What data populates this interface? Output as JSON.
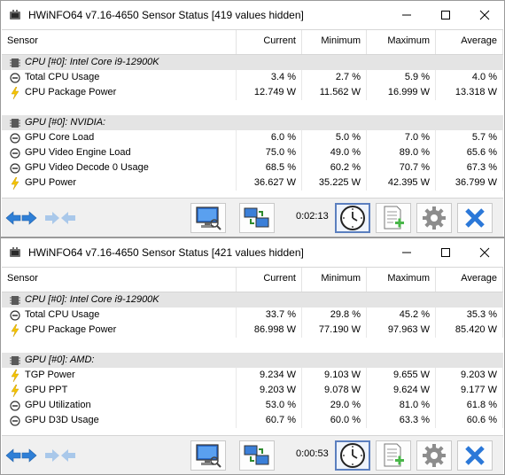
{
  "windows": [
    {
      "title": "HWiNFO64 v7.16-4650 Sensor Status [419 values hidden]",
      "columns": [
        "Sensor",
        "Current",
        "Minimum",
        "Maximum",
        "Average"
      ],
      "rows": [
        {
          "type": "group",
          "label": "CPU [#0]: Intel Core i9-12900K"
        },
        {
          "type": "data",
          "icon": "gauge-icon",
          "label": "Total CPU Usage",
          "cur": "3.4 %",
          "min": "2.7 %",
          "max": "5.9 %",
          "avg": "4.0 %"
        },
        {
          "type": "data",
          "icon": "power-bolt-icon",
          "label": "CPU Package Power",
          "cur": "12.749 W",
          "min": "11.562 W",
          "max": "16.999 W",
          "avg": "13.318 W"
        },
        {
          "type": "blank"
        },
        {
          "type": "group",
          "label": "GPU [#0]: NVIDIA:"
        },
        {
          "type": "data",
          "icon": "gauge-icon",
          "label": "GPU Core Load",
          "cur": "6.0 %",
          "min": "5.0 %",
          "max": "7.0 %",
          "avg": "5.7 %"
        },
        {
          "type": "data",
          "icon": "gauge-icon",
          "label": "GPU Video Engine Load",
          "cur": "75.0 %",
          "min": "49.0 %",
          "max": "89.0 %",
          "avg": "65.6 %"
        },
        {
          "type": "data",
          "icon": "gauge-icon",
          "label": "GPU Video Decode 0 Usage",
          "cur": "68.5 %",
          "min": "60.2 %",
          "max": "70.7 %",
          "avg": "67.3 %"
        },
        {
          "type": "data",
          "icon": "power-bolt-icon",
          "label": "GPU Power",
          "cur": "36.627 W",
          "min": "35.225 W",
          "max": "42.395 W",
          "avg": "36.799 W"
        }
      ],
      "timer": "0:02:13"
    },
    {
      "title": "HWiNFO64 v7.16-4650 Sensor Status [421 values hidden]",
      "columns": [
        "Sensor",
        "Current",
        "Minimum",
        "Maximum",
        "Average"
      ],
      "rows": [
        {
          "type": "group",
          "label": "CPU [#0]: Intel Core i9-12900K"
        },
        {
          "type": "data",
          "icon": "gauge-icon",
          "label": "Total CPU Usage",
          "cur": "33.7 %",
          "min": "29.8 %",
          "max": "45.2 %",
          "avg": "35.3 %"
        },
        {
          "type": "data",
          "icon": "power-bolt-icon",
          "label": "CPU Package Power",
          "cur": "86.998 W",
          "min": "77.190 W",
          "max": "97.963 W",
          "avg": "85.420 W"
        },
        {
          "type": "blank"
        },
        {
          "type": "group",
          "label": "GPU [#0]: AMD:"
        },
        {
          "type": "data",
          "icon": "power-bolt-icon",
          "label": "TGP Power",
          "cur": "9.234 W",
          "min": "9.103 W",
          "max": "9.655 W",
          "avg": "9.203 W"
        },
        {
          "type": "data",
          "icon": "power-bolt-icon",
          "label": "GPU PPT",
          "cur": "9.203 W",
          "min": "9.078 W",
          "max": "9.624 W",
          "avg": "9.177 W"
        },
        {
          "type": "data",
          "icon": "gauge-icon",
          "label": "GPU Utilization",
          "cur": "53.0 %",
          "min": "29.0 %",
          "max": "81.0 %",
          "avg": "61.8 %"
        },
        {
          "type": "data",
          "icon": "gauge-icon",
          "label": "GPU D3D Usage",
          "cur": "60.7 %",
          "min": "60.0 %",
          "max": "63.3 %",
          "avg": "60.6 %"
        }
      ],
      "timer": "0:00:53"
    }
  ],
  "colors": {
    "group_bg": "#e4e4e4",
    "accent_blue": "#2f7fd6",
    "bolt_yellow": "#f5c400",
    "close_x": "#2b78d8"
  }
}
